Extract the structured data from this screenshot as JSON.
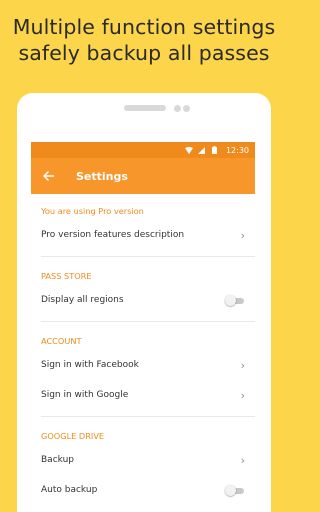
{
  "headline": {
    "line1": "Multiple function settings",
    "line2": "safely backup all passes"
  },
  "status_bar": {
    "time": "12:30",
    "icons": [
      "wifi-icon",
      "signal-icon",
      "battery-icon"
    ]
  },
  "app_bar": {
    "back_icon": "arrow-left-icon",
    "title": "Settings"
  },
  "pro": {
    "header": "You are using Pro version",
    "item": "Pro version features description"
  },
  "pass_store": {
    "header": "PASS STORE",
    "display_all_regions": "Display all regions",
    "display_all_regions_on": false
  },
  "account": {
    "header": "ACCOUNT",
    "facebook": "Sign in with Facebook",
    "google": "Sign in with Google"
  },
  "google_drive": {
    "header": "GOOGLE DRIVE",
    "backup": "Backup",
    "auto_backup": "Auto backup",
    "auto_backup_on": false
  },
  "colors": {
    "background": "#FCD54A",
    "appbar": "#F7962A",
    "statusbar": "#F08A1D",
    "accent": "#F08A1D"
  }
}
